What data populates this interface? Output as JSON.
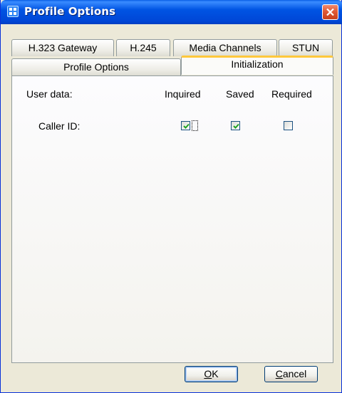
{
  "window": {
    "title": "Profile Options",
    "accent": "#0054e3",
    "close_color": "#e05a37"
  },
  "tabs": {
    "row_back": [
      "H.323 Gateway",
      "H.245",
      "Media Channels",
      "STUN"
    ],
    "row_front": [
      "Profile Options",
      "Initialization"
    ],
    "active": "Initialization"
  },
  "panel": {
    "row_label": "User data:",
    "columns": [
      "Inquired",
      "Saved",
      "Required"
    ],
    "rows": [
      {
        "label": "Caller ID:",
        "inquired": true,
        "saved": true,
        "required": false
      }
    ]
  },
  "buttons": {
    "ok": {
      "mnemonic": "O",
      "rest": "K"
    },
    "cancel": {
      "mnemonic": "C",
      "rest": "ancel"
    }
  }
}
